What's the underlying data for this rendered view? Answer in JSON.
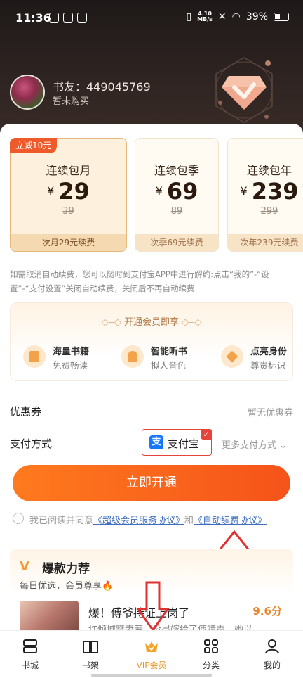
{
  "status_bar": {
    "time": "11:36",
    "network_speed": "4.10",
    "network_unit": "MB/s",
    "battery": "39%"
  },
  "user": {
    "name": "书友：449045769",
    "status": "暂未购买"
  },
  "plans": [
    {
      "tag": "立减10元",
      "name": "连续包月",
      "currency": "¥",
      "price": "29",
      "original": "39",
      "renewal": "次月29元续费",
      "selected": true
    },
    {
      "tag": "",
      "name": "连续包季",
      "currency": "¥",
      "price": "69",
      "original": "89",
      "renewal": "次季69元续费",
      "selected": false
    },
    {
      "tag": "",
      "name": "连续包年",
      "currency": "¥",
      "price": "239",
      "original": "299",
      "renewal": "次年239元续费",
      "selected": false
    }
  ],
  "notice": "如需取消自动续费，您可以随时到支付宝APP中进行解约:点击“我的”-“设置”-“支付设置”关闭自动续费，关闭后不再自动续费",
  "benefits": {
    "title": "开通会员即享",
    "items": [
      {
        "icon": "book-icon",
        "title": "海量书籍",
        "subtitle": "免费畅读"
      },
      {
        "icon": "headphones-icon",
        "title": "智能听书",
        "subtitle": "拟人音色"
      },
      {
        "icon": "badge-icon",
        "title": "点亮身份",
        "subtitle": "尊贵标识"
      }
    ]
  },
  "coupon": {
    "label": "优惠券",
    "value": "暂无优惠券"
  },
  "payment": {
    "label": "支付方式",
    "selected": "支付宝",
    "more": "更多支付方式"
  },
  "cta_label": "立即开通",
  "agreement": {
    "prefix": "我已阅读并同意",
    "link1": "《超级会员服务协议》",
    "conjunction": "和",
    "link2": "《自动续费协议》"
  },
  "recommend": {
    "title": "爆款力荐",
    "subtitle": "每日优选，会员尊享🔥",
    "book": {
      "title": "爆！傅爷持证上岗了",
      "score": "9.6分",
      "desc": "许倾城簪妻若，没出嫁给了傅靖霆，她以..."
    }
  },
  "tabs": [
    {
      "label": "书城",
      "icon": "bookstore-icon",
      "active": false
    },
    {
      "label": "书架",
      "icon": "bookshelf-icon",
      "active": false
    },
    {
      "label": "VIP会员",
      "icon": "crown-icon",
      "active": true
    },
    {
      "label": "分类",
      "icon": "grid-icon",
      "active": false
    },
    {
      "label": "我的",
      "icon": "person-icon",
      "active": false
    }
  ],
  "colors": {
    "accent": "#f5531a",
    "gold": "#e09a2e",
    "annotation_red": "#e03030",
    "link": "#3d6ec0"
  }
}
